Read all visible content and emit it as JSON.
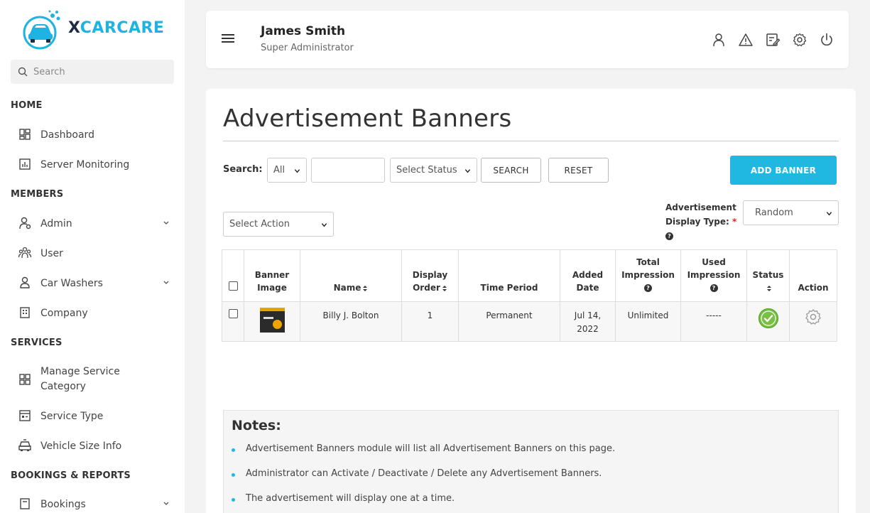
{
  "brand": {
    "logo_x": "X",
    "logo_rest": "CARCARE",
    "accent_color": "#20b7e0"
  },
  "sidebar": {
    "search_placeholder": "Search",
    "sections": {
      "home": "HOME",
      "members": "MEMBERS",
      "services": "SERVICES",
      "bookings": "BOOKINGS & REPORTS"
    },
    "items": {
      "dashboard": "Dashboard",
      "server_monitoring": "Server Monitoring",
      "admin": "Admin",
      "user": "User",
      "car_washers": "Car Washers",
      "company": "Company",
      "manage_service_category": "Manage Service Category",
      "service_type": "Service Type",
      "vehicle_size_info": "Vehicle Size Info",
      "bookings": "Bookings"
    }
  },
  "header": {
    "user_name": "James Smith",
    "user_role": "Super Administrator",
    "icons": [
      "user-icon",
      "warning-icon",
      "edit-icon",
      "settings-icon",
      "power-icon"
    ]
  },
  "page": {
    "title": "Advertisement Banners",
    "search_label": "Search:",
    "search_scope": "All",
    "status_select": "Select Status",
    "search_button": "SEARCH",
    "reset_button": "RESET",
    "add_button": "ADD BANNER",
    "action_select": "Select Action",
    "display_type_label_1": "Advertisement",
    "display_type_label_2": "Display Type:",
    "display_type_required": "*",
    "display_type_value": "Random"
  },
  "table": {
    "headers": {
      "banner_image_1": "Banner",
      "banner_image_2": "Image",
      "name": "Name",
      "display_order_1": "Display",
      "display_order_2": "Order",
      "time_period": "Time Period",
      "added_date_1": "Added",
      "added_date_2": "Date",
      "total_impression_1": "Total",
      "total_impression_2": "Impression",
      "used_impression_1": "Used",
      "used_impression_2": "Impression",
      "status": "Status",
      "action": "Action"
    },
    "rows": [
      {
        "name": "Billy J. Bolton",
        "display_order": "1",
        "time_period": "Permanent",
        "added_date_1": "Jul 14,",
        "added_date_2": "2022",
        "total_impression": "Unlimited",
        "used_impression": "-----",
        "status": "active"
      }
    ]
  },
  "notes": {
    "title": "Notes:",
    "items": [
      "Advertisement Banners module will list all Advertisement Banners on this page.",
      "Administrator can Activate / Deactivate / Delete any Advertisement Banners.",
      "The advertisement will display one at a time."
    ]
  }
}
